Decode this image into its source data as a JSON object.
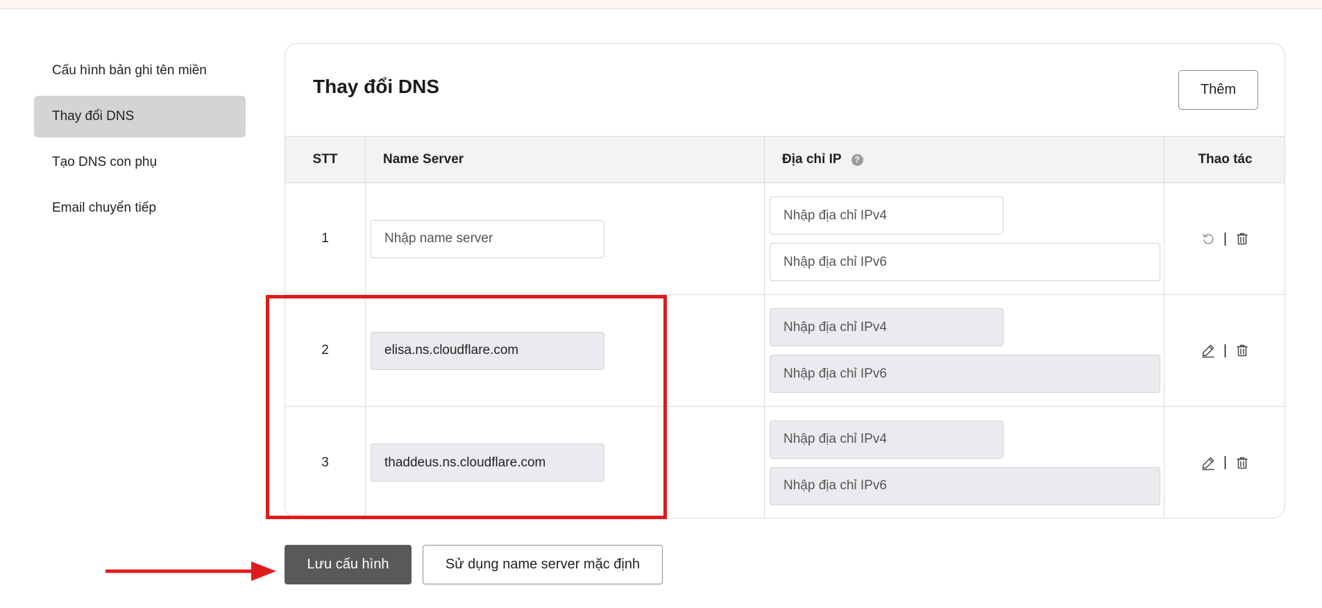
{
  "sidebar": {
    "items": [
      {
        "label": "Cấu hình bản ghi tên miền",
        "active": false
      },
      {
        "label": "Thay đổi DNS",
        "active": true
      },
      {
        "label": "Tạo DNS con phụ",
        "active": false
      },
      {
        "label": "Email chuyển tiếp",
        "active": false
      }
    ]
  },
  "card": {
    "title": "Thay đổi DNS",
    "add_label": "Thêm"
  },
  "table": {
    "headers": {
      "stt": "STT",
      "name_server": "Name Server",
      "ip": "Địa chỉ IP",
      "help_icon": "?",
      "actions": "Thao tác"
    },
    "rows": [
      {
        "stt": "1",
        "name_server": "",
        "name_server_placeholder": "Nhập name server",
        "ipv4_placeholder": "Nhập địa chỉ IPv4",
        "ipv6_placeholder": "Nhập địa chỉ IPv6",
        "editable": true,
        "action_icons": [
          "undo-icon",
          "trash-icon"
        ]
      },
      {
        "stt": "2",
        "name_server": "elisa.ns.cloudflare.com",
        "name_server_placeholder": "Nhập name server",
        "ipv4_placeholder": "Nhập địa chỉ IPv4",
        "ipv6_placeholder": "Nhập địa chỉ IPv6",
        "editable": false,
        "action_icons": [
          "pencil-icon",
          "trash-icon"
        ]
      },
      {
        "stt": "3",
        "name_server": "thaddeus.ns.cloudflare.com",
        "name_server_placeholder": "Nhập name server",
        "ipv4_placeholder": "Nhập địa chỉ IPv4",
        "ipv6_placeholder": "Nhập địa chỉ IPv6",
        "editable": false,
        "action_icons": [
          "pencil-icon",
          "trash-icon"
        ]
      }
    ],
    "separator": "|"
  },
  "buttons": {
    "save_label": "Lưu cấu hình",
    "default_label": "Sử dụng name server mặc định"
  },
  "colors": {
    "annotation": "#e01b1b",
    "save_button": "#58595b",
    "active_sidebar": "#d3d4d6",
    "disabled_input": "#e9ebee"
  }
}
